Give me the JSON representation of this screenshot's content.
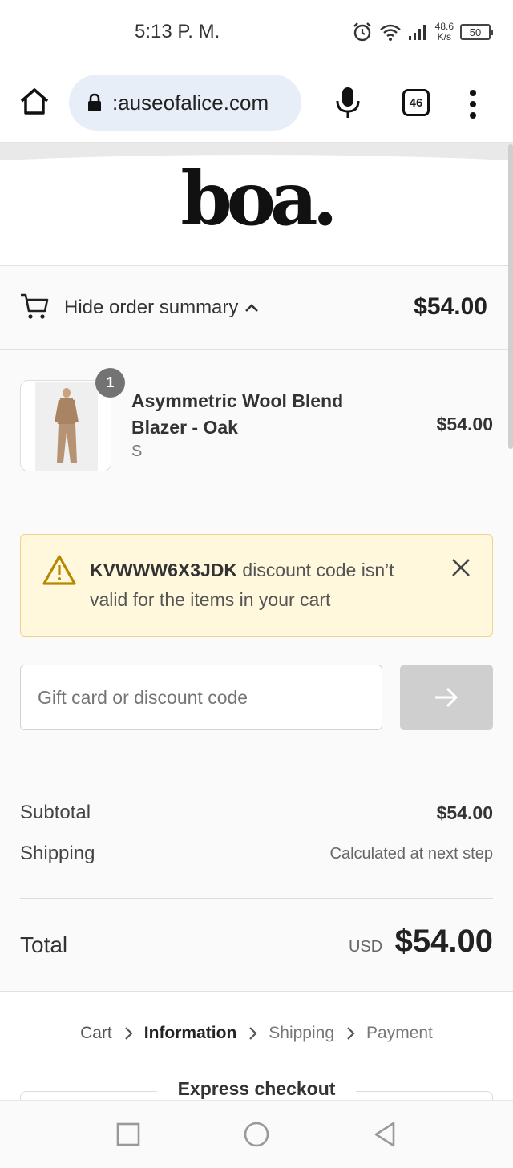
{
  "status_bar": {
    "time": "5:13 P. M.",
    "net_speed_value": "48.6",
    "net_speed_unit": "K/s",
    "battery": "50"
  },
  "browser": {
    "url": ":auseofalice.com",
    "tab_count": "46"
  },
  "store": {
    "logo": "boa."
  },
  "order_summary": {
    "toggle_label": "Hide order summary",
    "total": "$54.00"
  },
  "line_item": {
    "quantity": "1",
    "name": "Asymmetric Wool Blend Blazer - Oak",
    "variant": "S",
    "price": "$54.00"
  },
  "alert": {
    "code": "KVWWW6X3JDK",
    "message": " discount code isn’t valid for the items in your cart"
  },
  "discount": {
    "placeholder": "Gift card or discount code"
  },
  "totals": {
    "subtotal_label": "Subtotal",
    "subtotal_value": "$54.00",
    "shipping_label": "Shipping",
    "shipping_value": "Calculated at next step",
    "total_label": "Total",
    "currency": "USD",
    "total_value": "$54.00"
  },
  "breadcrumb": {
    "items": [
      "Cart",
      "Information",
      "Shipping",
      "Payment"
    ]
  },
  "express_checkout": {
    "label": "Express checkout"
  },
  "colors": {
    "alert_background": "#fff8dc",
    "alert_border": "#edd389",
    "alert_icon": "#b58a00",
    "apply_button_disabled": "#cfcfcf",
    "url_pill": "#e8eef8"
  },
  "icons": [
    "home-icon",
    "lock-icon",
    "mic-icon",
    "tabs-icon",
    "more-vert-icon",
    "cart-icon",
    "chevron-up-icon",
    "warning-icon",
    "close-icon",
    "arrow-right-icon",
    "chevron-right-icon",
    "square-icon",
    "circle-icon",
    "triangle-back-icon",
    "alarm-icon",
    "wifi-icon",
    "signal-icon"
  ]
}
